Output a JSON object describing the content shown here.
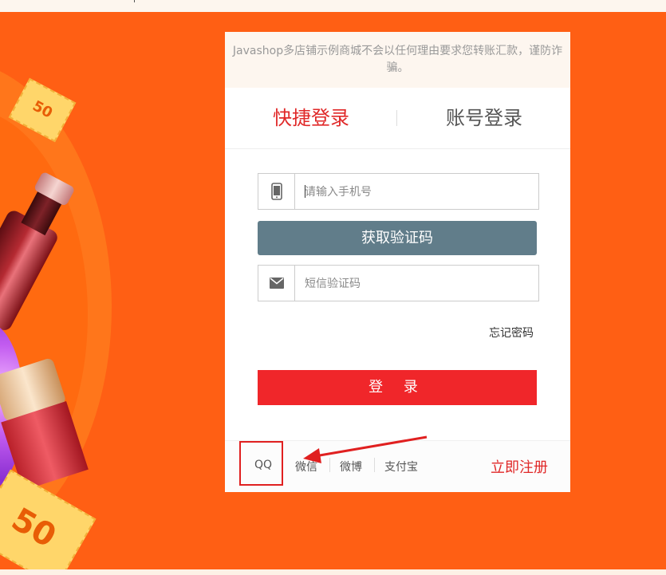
{
  "notice": {
    "text": "Javashop多店铺示例商城不会以任何理由要求您转账汇款，谨防诈骗。"
  },
  "tabs": [
    {
      "label": "快捷登录",
      "active": true
    },
    {
      "label": "账号登录",
      "active": false
    }
  ],
  "form": {
    "phone": {
      "placeholder": "请输入手机号",
      "value": "",
      "icon": "phone-icon"
    },
    "get_code_label": "获取验证码",
    "sms_code": {
      "placeholder": "短信验证码",
      "value": "",
      "icon": "mail-icon"
    },
    "forgot_label": "忘记密码",
    "login_label": "登 录"
  },
  "footer": {
    "social": [
      "QQ",
      "微信",
      "微博",
      "支付宝"
    ],
    "register_label": "立即注册"
  },
  "promo": {
    "ticket_small": "50",
    "ticket_large": "50"
  },
  "colors": {
    "background": "#ff5f14",
    "accent_red": "#e02828",
    "login_button": "#f0262a",
    "code_button": "#617d8a",
    "annotation": "#e02020"
  }
}
